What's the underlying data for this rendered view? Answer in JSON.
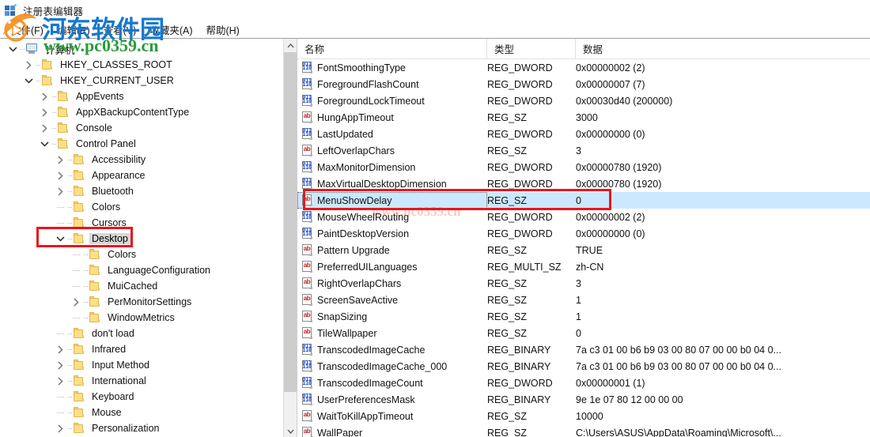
{
  "window": {
    "title": "注册表编辑器",
    "icon": "registry-editor-icon"
  },
  "menubar": {
    "items": [
      {
        "label": "文件(F)",
        "name": "menu-file"
      },
      {
        "label": "编辑(E)",
        "name": "menu-edit"
      },
      {
        "label": "查看(V)",
        "name": "menu-view"
      },
      {
        "label": "收藏夹(A)",
        "name": "menu-favorites"
      },
      {
        "label": "帮助(H)",
        "name": "menu-help"
      }
    ]
  },
  "tree": {
    "root_label": "计算机",
    "nodes": [
      {
        "label": "计算机",
        "depth": 0,
        "twist": "down",
        "icon": "computer-icon"
      },
      {
        "label": "HKEY_CLASSES_ROOT",
        "depth": 1,
        "twist": "right",
        "icon": "folder-icon"
      },
      {
        "label": "HKEY_CURRENT_USER",
        "depth": 1,
        "twist": "down",
        "icon": "folder-icon"
      },
      {
        "label": "AppEvents",
        "depth": 2,
        "twist": "right",
        "icon": "folder-icon"
      },
      {
        "label": "AppXBackupContentType",
        "depth": 2,
        "twist": "right",
        "icon": "folder-icon"
      },
      {
        "label": "Console",
        "depth": 2,
        "twist": "right",
        "icon": "folder-icon"
      },
      {
        "label": "Control Panel",
        "depth": 2,
        "twist": "down",
        "icon": "folder-icon"
      },
      {
        "label": "Accessibility",
        "depth": 3,
        "twist": "right",
        "icon": "folder-icon"
      },
      {
        "label": "Appearance",
        "depth": 3,
        "twist": "right",
        "icon": "folder-icon"
      },
      {
        "label": "Bluetooth",
        "depth": 3,
        "twist": "right",
        "icon": "folder-icon"
      },
      {
        "label": "Colors",
        "depth": 3,
        "twist": "none",
        "icon": "folder-icon"
      },
      {
        "label": "Cursors",
        "depth": 3,
        "twist": "none",
        "icon": "folder-icon"
      },
      {
        "label": "Desktop",
        "depth": 3,
        "twist": "down",
        "icon": "folder-icon",
        "selected": true
      },
      {
        "label": "Colors",
        "depth": 4,
        "twist": "none",
        "icon": "folder-icon"
      },
      {
        "label": "LanguageConfiguration",
        "depth": 4,
        "twist": "none",
        "icon": "folder-icon"
      },
      {
        "label": "MuiCached",
        "depth": 4,
        "twist": "none",
        "icon": "folder-icon"
      },
      {
        "label": "PerMonitorSettings",
        "depth": 4,
        "twist": "right",
        "icon": "folder-icon"
      },
      {
        "label": "WindowMetrics",
        "depth": 4,
        "twist": "none",
        "icon": "folder-icon"
      },
      {
        "label": "don't load",
        "depth": 3,
        "twist": "none",
        "icon": "folder-icon"
      },
      {
        "label": "Infrared",
        "depth": 3,
        "twist": "right",
        "icon": "folder-icon"
      },
      {
        "label": "Input Method",
        "depth": 3,
        "twist": "right",
        "icon": "folder-icon"
      },
      {
        "label": "International",
        "depth": 3,
        "twist": "right",
        "icon": "folder-icon"
      },
      {
        "label": "Keyboard",
        "depth": 3,
        "twist": "none",
        "icon": "folder-icon"
      },
      {
        "label": "Mouse",
        "depth": 3,
        "twist": "none",
        "icon": "folder-icon"
      },
      {
        "label": "Personalization",
        "depth": 3,
        "twist": "right",
        "icon": "folder-icon"
      }
    ]
  },
  "list": {
    "columns": [
      {
        "label": "名称",
        "name": "column-name"
      },
      {
        "label": "类型",
        "name": "column-type"
      },
      {
        "label": "数据",
        "name": "column-data"
      }
    ],
    "rows": [
      {
        "name": "FontSmoothingType",
        "type": "REG_DWORD",
        "data": "0x00000002 (2)",
        "icon": "dword-value-icon"
      },
      {
        "name": "ForegroundFlashCount",
        "type": "REG_DWORD",
        "data": "0x00000007 (7)",
        "icon": "dword-value-icon"
      },
      {
        "name": "ForegroundLockTimeout",
        "type": "REG_DWORD",
        "data": "0x00030d40 (200000)",
        "icon": "dword-value-icon"
      },
      {
        "name": "HungAppTimeout",
        "type": "REG_SZ",
        "data": "3000",
        "icon": "string-value-icon"
      },
      {
        "name": "LastUpdated",
        "type": "REG_DWORD",
        "data": "0x00000000 (0)",
        "icon": "dword-value-icon"
      },
      {
        "name": "LeftOverlapChars",
        "type": "REG_SZ",
        "data": "3",
        "icon": "string-value-icon"
      },
      {
        "name": "MaxMonitorDimension",
        "type": "REG_DWORD",
        "data": "0x00000780 (1920)",
        "icon": "dword-value-icon"
      },
      {
        "name": "MaxVirtualDesktopDimension",
        "type": "REG_DWORD",
        "data": "0x00000780 (1920)",
        "icon": "dword-value-icon"
      },
      {
        "name": "MenuShowDelay",
        "type": "REG_SZ",
        "data": "0",
        "icon": "string-value-icon",
        "selected": true
      },
      {
        "name": "MouseWheelRouting",
        "type": "REG_DWORD",
        "data": "0x00000002 (2)",
        "icon": "dword-value-icon"
      },
      {
        "name": "PaintDesktopVersion",
        "type": "REG_DWORD",
        "data": "0x00000000 (0)",
        "icon": "dword-value-icon"
      },
      {
        "name": "Pattern Upgrade",
        "type": "REG_SZ",
        "data": "TRUE",
        "icon": "string-value-icon"
      },
      {
        "name": "PreferredUILanguages",
        "type": "REG_MULTI_SZ",
        "data": "zh-CN",
        "icon": "string-value-icon"
      },
      {
        "name": "RightOverlapChars",
        "type": "REG_SZ",
        "data": "3",
        "icon": "string-value-icon"
      },
      {
        "name": "ScreenSaveActive",
        "type": "REG_SZ",
        "data": "1",
        "icon": "string-value-icon"
      },
      {
        "name": "SnapSizing",
        "type": "REG_SZ",
        "data": "1",
        "icon": "string-value-icon"
      },
      {
        "name": "TileWallpaper",
        "type": "REG_SZ",
        "data": "0",
        "icon": "string-value-icon"
      },
      {
        "name": "TranscodedImageCache",
        "type": "REG_BINARY",
        "data": "7a c3 01 00 b6 b9 03 00 80 07 00 00 b0 04 0...",
        "icon": "binary-value-icon"
      },
      {
        "name": "TranscodedImageCache_000",
        "type": "REG_BINARY",
        "data": "7a c3 01 00 b6 b9 03 00 80 07 00 00 b0 04 0...",
        "icon": "binary-value-icon"
      },
      {
        "name": "TranscodedImageCount",
        "type": "REG_DWORD",
        "data": "0x00000001 (1)",
        "icon": "dword-value-icon"
      },
      {
        "name": "UserPreferencesMask",
        "type": "REG_BINARY",
        "data": "9e 1e 07 80 12 00 00 00",
        "icon": "binary-value-icon"
      },
      {
        "name": "WaitToKillAppTimeout",
        "type": "REG_SZ",
        "data": "10000",
        "icon": "string-value-icon"
      },
      {
        "name": "WallPaper",
        "type": "REG_SZ",
        "data": "C:\\Users\\ASUS\\AppData\\Roaming\\Microsoft\\...",
        "icon": "string-value-icon"
      }
    ]
  },
  "watermark": {
    "site_name": "河东软件园",
    "site_url": "www.pc0359.cn",
    "faint_url": "www.pc0359.cn",
    "color_cn": "#1479d0",
    "color_url": "#2b9c3a",
    "color_logo": "#f59120"
  },
  "annotations": {
    "highlight_color": "#e8161c",
    "selection_color": "#cce8ff",
    "tree_selection_color": "#d8d8d8"
  }
}
